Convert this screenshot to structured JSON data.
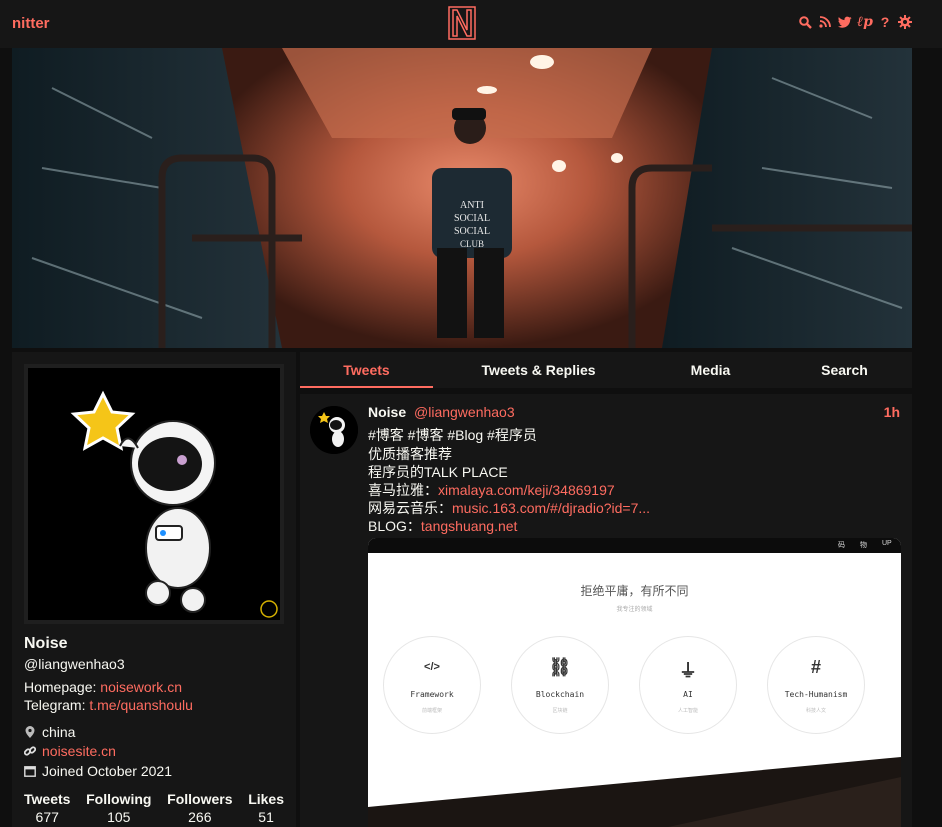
{
  "nav": {
    "brand": "nitter",
    "logo_letter": "N",
    "icons": [
      "search-icon",
      "rss-icon",
      "twitter-bird-icon",
      "liberapay-icon",
      "help-icon",
      "settings-gear-icon"
    ],
    "help_glyph": "?"
  },
  "profile": {
    "name": "Noise",
    "handle": "@liangwenhao3",
    "bio": {
      "homepage_label": "Homepage:",
      "homepage_link": "noisework.cn",
      "telegram_label": "Telegram:",
      "telegram_link": "t.me/quanshoulu"
    },
    "location": "china",
    "website": "noisesite.cn",
    "joined": "Joined October 2021",
    "stats": [
      {
        "label": "Tweets",
        "value": "677"
      },
      {
        "label": "Following",
        "value": "105"
      },
      {
        "label": "Followers",
        "value": "266"
      },
      {
        "label": "Likes",
        "value": "51"
      }
    ]
  },
  "tabs": [
    {
      "label": "Tweets",
      "active": true
    },
    {
      "label": "Tweets & Replies",
      "active": false
    },
    {
      "label": "Media",
      "active": false
    },
    {
      "label": "Search",
      "active": false
    }
  ],
  "tweet": {
    "name": "Noise",
    "username": "@liangwenhao3",
    "date": "1h",
    "hashtags": "#博客 #博客 #Blog #程序员",
    "line1": "优质播客推荐",
    "line2": "程序员的TALK PLACE",
    "ximalaya_label": "喜马拉雅：",
    "ximalaya_link": "ximalaya.com/keji/34869197",
    "netease_label": "网易云音乐：",
    "netease_link": "music.163.com/#/djradio?id=7...",
    "blog_label": "BLOG：",
    "blog_link": "tangshuang.net",
    "image": {
      "topbar": [
        "码",
        "物",
        "UP"
      ],
      "title": "拒绝平庸，有所不同",
      "subtitle": "我专注的领域",
      "cards": [
        {
          "icon": "file-code-icon",
          "glyph": "</>",
          "label": "Framework",
          "sub": "前端框架"
        },
        {
          "icon": "chain-icon",
          "glyph": "⛓",
          "label": "Blockchain",
          "sub": "区块链"
        },
        {
          "icon": "plug-icon",
          "glyph": "⏚",
          "label": "AI",
          "sub": "人工智能"
        },
        {
          "icon": "hashtag-icon",
          "glyph": "#",
          "label": "Tech-Humanism",
          "sub": "科技人文"
        }
      ]
    }
  },
  "colors": {
    "accent": "#ff6c60",
    "bg": "#0f0f0f",
    "panel": "#161616",
    "text": "#f8f8f2"
  }
}
